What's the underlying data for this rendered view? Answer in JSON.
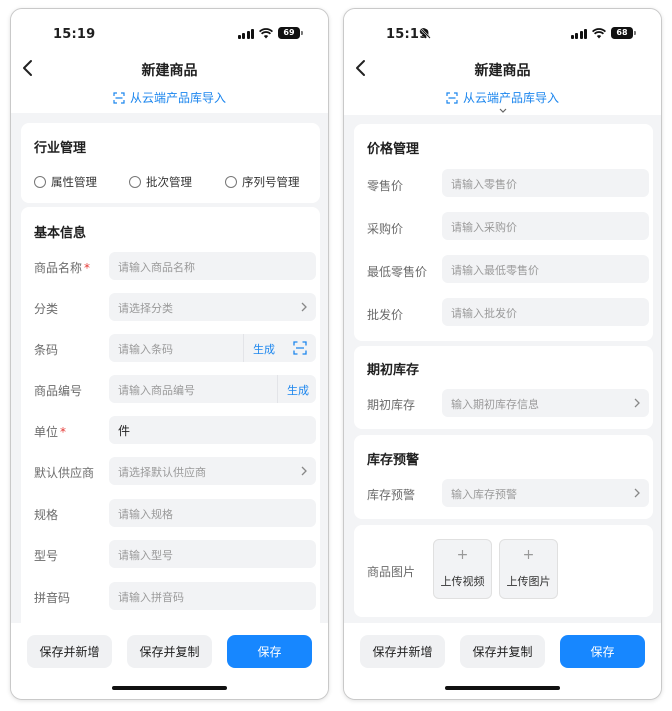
{
  "colors": {
    "accent": "#1787ff",
    "link": "#1c86ee",
    "required": "#e53935"
  },
  "left": {
    "status": {
      "time": "15:19",
      "battery": "69"
    },
    "nav": {
      "title": "新建商品",
      "import": "从云端产品库导入"
    },
    "industry": {
      "title": "行业管理",
      "options": [
        "属性管理",
        "批次管理",
        "序列号管理"
      ]
    },
    "basic": {
      "title": "基本信息",
      "name": {
        "label": "商品名称",
        "required": "*",
        "placeholder": "请输入商品名称"
      },
      "category": {
        "label": "分类",
        "placeholder": "请选择分类"
      },
      "barcode": {
        "label": "条码",
        "placeholder": "请输入条码",
        "action": "生成"
      },
      "code": {
        "label": "商品编号",
        "placeholder": "请输入商品编号",
        "action": "生成"
      },
      "unit": {
        "label": "单位",
        "required": "*",
        "value": "件"
      },
      "supplier": {
        "label": "默认供应商",
        "placeholder": "请选择默认供应商"
      },
      "spec": {
        "label": "规格",
        "placeholder": "请输入规格"
      },
      "model": {
        "label": "型号",
        "placeholder": "请输入型号"
      },
      "pinyin": {
        "label": "拼音码",
        "placeholder": "请输入拼音码"
      }
    },
    "buttons": {
      "save_new": "保存并新增",
      "save_copy": "保存并复制",
      "save": "保存"
    }
  },
  "right": {
    "status": {
      "time": "15:19",
      "battery": "68"
    },
    "nav": {
      "title": "新建商品",
      "import": "从云端产品库导入"
    },
    "price": {
      "title": "价格管理",
      "retail": {
        "label": "零售价",
        "placeholder": "请输入零售价"
      },
      "purchase": {
        "label": "采购价",
        "placeholder": "请输入采购价"
      },
      "min_retail": {
        "label": "最低零售价",
        "placeholder": "请输入最低零售价"
      },
      "wholesale": {
        "label": "批发价",
        "placeholder": "请输入批发价"
      }
    },
    "opening": {
      "title": "期初库存",
      "label": "期初库存",
      "placeholder": "输入期初库存信息"
    },
    "warning": {
      "title": "库存预警",
      "label": "库存预警",
      "placeholder": "输入库存预警"
    },
    "images": {
      "label": "商品图片",
      "video": "上传视频",
      "picture": "上传图片"
    },
    "buttons": {
      "save_new": "保存并新增",
      "save_copy": "保存并复制",
      "save": "保存"
    }
  }
}
